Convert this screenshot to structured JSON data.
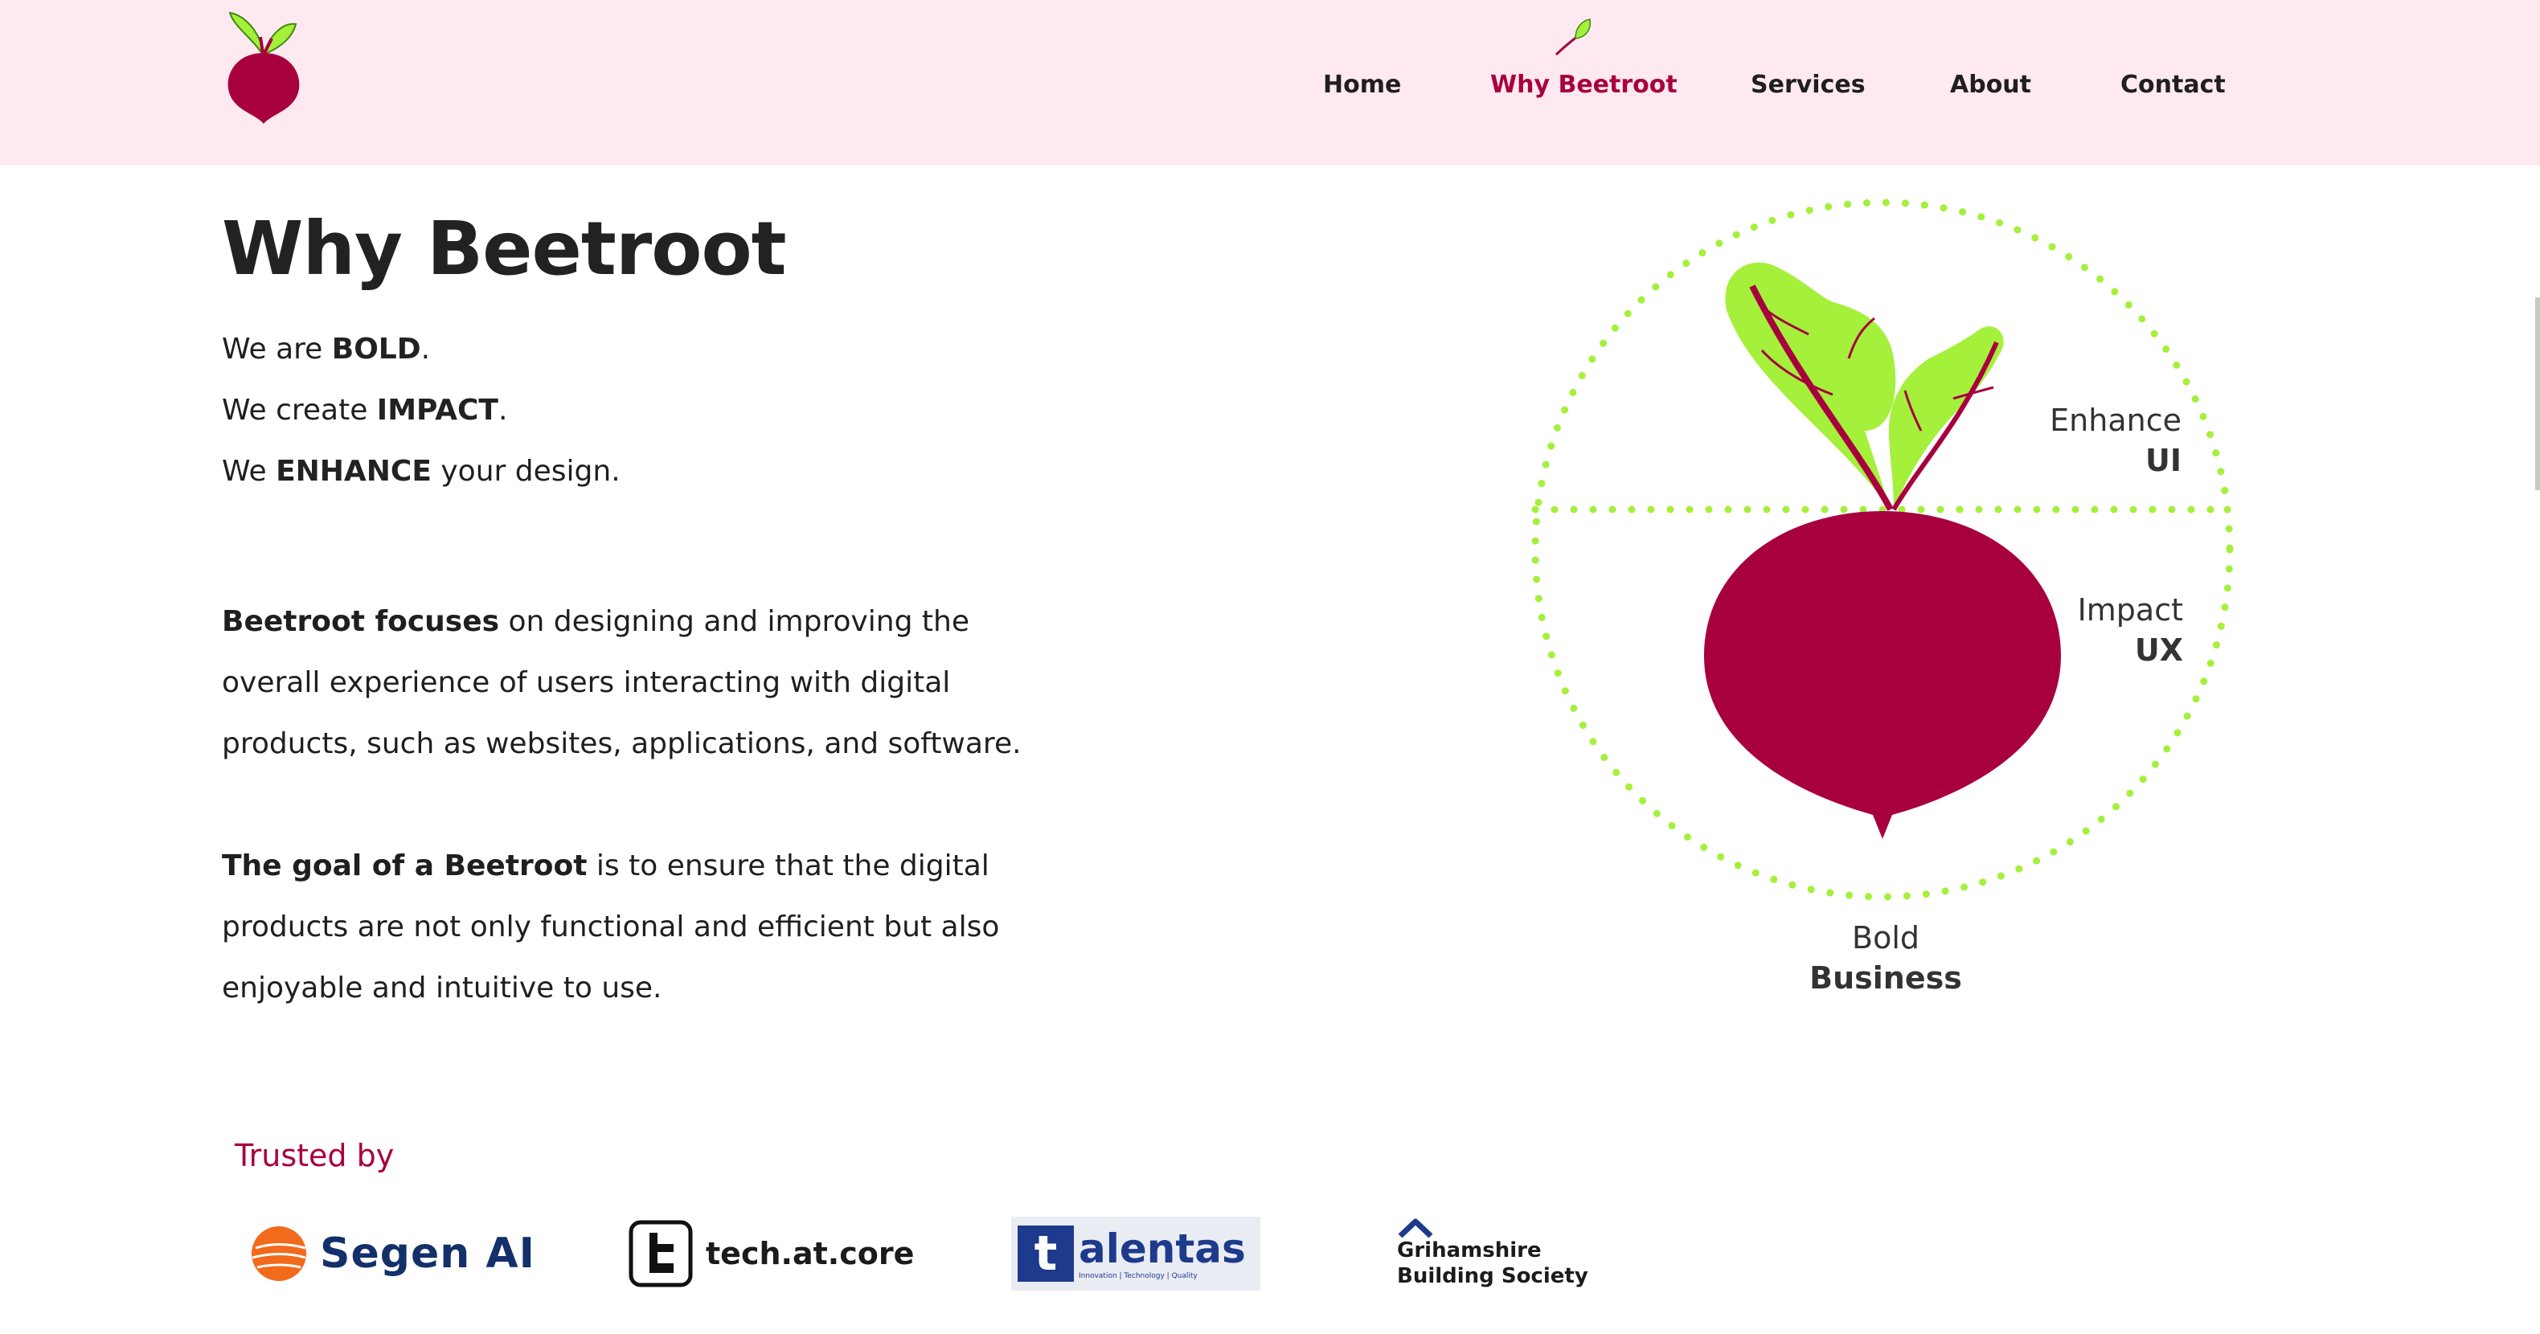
{
  "brand": {
    "name": "Beetroot",
    "accent": "#a8003e",
    "leaf": "#a4f03a",
    "header_bg": "#fde9ef"
  },
  "nav": {
    "items": [
      {
        "label": "Home",
        "active": false
      },
      {
        "label": "Why Beetroot",
        "active": true
      },
      {
        "label": "Services",
        "active": false
      },
      {
        "label": "About",
        "active": false
      },
      {
        "label": "Contact",
        "active": false
      }
    ]
  },
  "main": {
    "title": "Why Beetroot",
    "taglines": [
      {
        "pre": "We are ",
        "strong": "BOLD",
        "post": "."
      },
      {
        "pre": "We create ",
        "strong": "IMPACT",
        "post": "."
      },
      {
        "pre": "We ",
        "strong": "ENHANCE",
        "post": " your design."
      }
    ],
    "para1": {
      "strong": "Beetroot focuses",
      "text": " on designing and improving the overall experience of users interacting with digital products, such as websites, applications, and software."
    },
    "para2": {
      "strong": "The goal of a Beetroot",
      "text": " is to ensure that the digital products are not only functional and efficient but also enjoyable and intuitive to use."
    }
  },
  "diagram": {
    "enhance": {
      "top": "Enhance",
      "bottom": "UI"
    },
    "impact": {
      "top": "Impact",
      "bottom": "UX"
    },
    "bold": {
      "top": "Bold",
      "bottom": "Business"
    }
  },
  "trusted": {
    "heading": "Trusted by",
    "partners": {
      "segen": "Segen AI",
      "tech": "tech.at.core",
      "talentas_box": "t",
      "talentas_word": "alentas",
      "talentas_sub": "Innovation | Technology | Quality",
      "grih_line1": "Grihamshire",
      "grih_line2": "Building Society"
    }
  }
}
